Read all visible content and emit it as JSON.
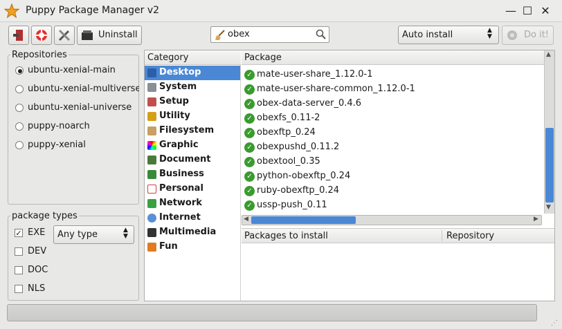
{
  "window": {
    "title": "Puppy Package Manager v2",
    "minimize": "—",
    "maximize": "☐",
    "close": "✕"
  },
  "toolbar": {
    "uninstall_label": "Uninstall",
    "search_value": "obex",
    "install_mode": "Auto install",
    "do_it_label": "Do it!"
  },
  "repositories": {
    "label": "Repositories",
    "items": [
      {
        "label": "ubuntu-xenial-main",
        "selected": true
      },
      {
        "label": "ubuntu-xenial-multiverse",
        "selected": false
      },
      {
        "label": "ubuntu-xenial-universe",
        "selected": false
      },
      {
        "label": "puppy-noarch",
        "selected": false
      },
      {
        "label": "puppy-xenial",
        "selected": false
      }
    ]
  },
  "package_types": {
    "label": "package types",
    "type_select": "Any type",
    "items": [
      {
        "label": "EXE",
        "checked": true
      },
      {
        "label": "DEV",
        "checked": false
      },
      {
        "label": "DOC",
        "checked": false
      },
      {
        "label": "NLS",
        "checked": false
      }
    ]
  },
  "category": {
    "header": "Category",
    "items": [
      {
        "label": "Desktop",
        "selected": true,
        "color": "#2d5ea8"
      },
      {
        "label": "System",
        "selected": false,
        "color": "#8a8f96"
      },
      {
        "label": "Setup",
        "selected": false,
        "color": "#c0504d"
      },
      {
        "label": "Utility",
        "selected": false,
        "color": "#d4a017"
      },
      {
        "label": "Filesystem",
        "selected": false,
        "color": "#c8a064"
      },
      {
        "label": "Graphic",
        "selected": false,
        "color": "#9b59b6"
      },
      {
        "label": "Document",
        "selected": false,
        "color": "#4a7a3a"
      },
      {
        "label": "Business",
        "selected": false,
        "color": "#3a8a3a"
      },
      {
        "label": "Personal",
        "selected": false,
        "color": "#d04040"
      },
      {
        "label": "Network",
        "selected": false,
        "color": "#3aa040"
      },
      {
        "label": "Internet",
        "selected": false,
        "color": "#5b8fd6"
      },
      {
        "label": "Multimedia",
        "selected": false,
        "color": "#333333"
      },
      {
        "label": "Fun",
        "selected": false,
        "color": "#e07b20"
      }
    ]
  },
  "packages": {
    "header": "Package",
    "items": [
      "mate-user-share_1.12.0-1",
      "mate-user-share-common_1.12.0-1",
      "obex-data-server_0.4.6",
      "obexfs_0.11-2",
      "obexftp_0.24",
      "obexpushd_0.11.2",
      "obextool_0.35",
      "python-obexftp_0.24",
      "ruby-obexftp_0.24",
      "ussp-push_0.11"
    ]
  },
  "install_list": {
    "col_packages": "Packages to install",
    "col_repository": "Repository"
  },
  "colors": {
    "accent": "#4a88d6",
    "ok_green": "#3a9b2f"
  }
}
